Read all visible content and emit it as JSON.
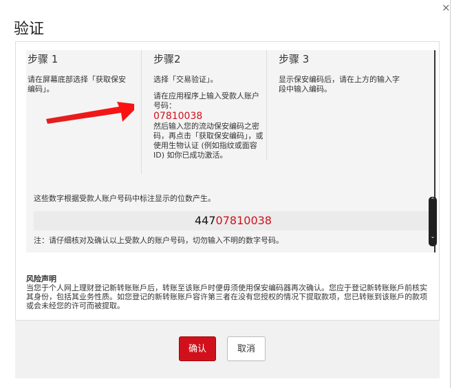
{
  "dialog": {
    "title": "验证",
    "close_icon": "×"
  },
  "steps": [
    {
      "title": "步骤 1",
      "text": "请在屏幕底部选择「获取保安编码」。"
    },
    {
      "title": "步骤2",
      "text": "选择「交易验证」。",
      "text2": "请在应用程序上输入受款人账户号码：",
      "account": "07810038",
      "text3": "然后输入您的流动保安编码之密码，再点击「获取保安编码」，或使用生物认证 (例如指纹或面容 ID) 如你已成功激活。"
    },
    {
      "title": "步骤 3",
      "text": "显示保安编码后，请在上方的输入字段中输入编码。"
    }
  ],
  "digits_note": "这些数字根据受款人账户号码中标注显示的位数产生。",
  "code": {
    "prefix": "447",
    "highlight": "07810038"
  },
  "warning_note": "注：请仔细核对及确认以上受款人的账户号码，切勿输入不明的数字号码。",
  "risk": {
    "title": "风险声明",
    "text": "当您于个人网上理财登记新转账账戶后，转账至该账戶时便毋须使用保安编码器再次确认。您应于登记新转账账戶前核实其身份，包括其业务性质。如您登记的新转账账戶容许第三者在没有您授权的情况下提取款项，您已转账到该账戶的款项或会未经您的许可而被提取。"
  },
  "buttons": {
    "confirm": "确认",
    "cancel": "取消"
  },
  "colors": {
    "accent": "#d0111b"
  }
}
